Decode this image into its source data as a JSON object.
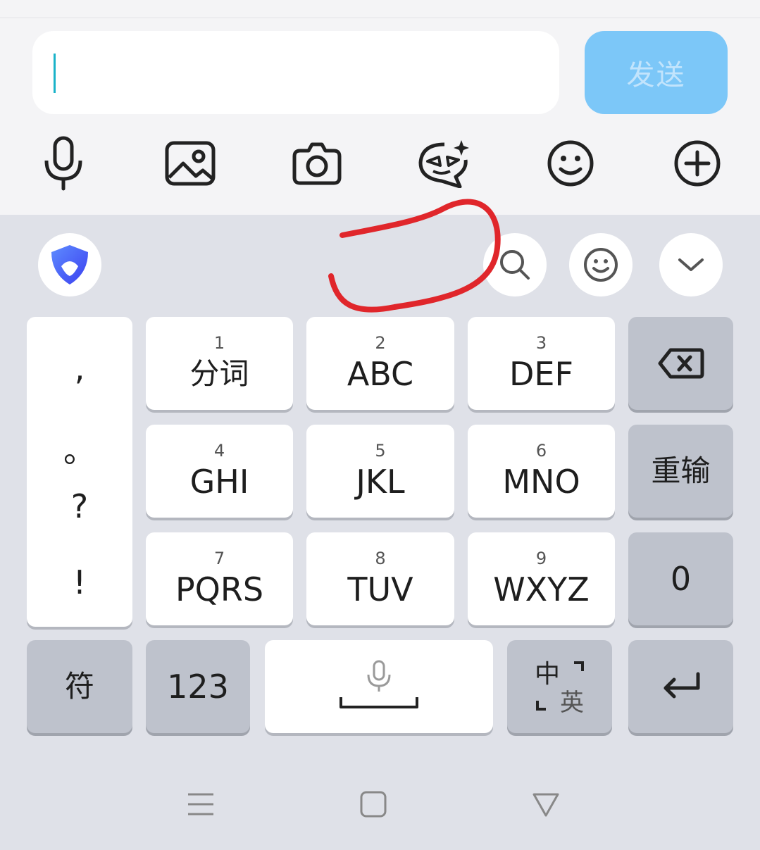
{
  "compose": {
    "input_value": "",
    "send_label": "发送"
  },
  "toolbar": {
    "icons": [
      "mic-icon",
      "image-icon",
      "camera-icon",
      "ai-assistant-icon",
      "emoji-icon",
      "plus-icon"
    ]
  },
  "keyboard": {
    "toolbar_icons": [
      "logo-icon",
      "search-icon",
      "emoji-icon",
      "collapse-icon"
    ],
    "punct": [
      ",",
      "。",
      "?",
      "!"
    ],
    "keys": [
      {
        "num": "1",
        "label": "分词"
      },
      {
        "num": "2",
        "label": "ABC"
      },
      {
        "num": "3",
        "label": "DEF"
      },
      {
        "num": "4",
        "label": "GHI"
      },
      {
        "num": "5",
        "label": "JKL"
      },
      {
        "num": "6",
        "label": "MNO"
      },
      {
        "num": "7",
        "label": "PQRS"
      },
      {
        "num": "8",
        "label": "TUV"
      },
      {
        "num": "9",
        "label": "WXYZ"
      }
    ],
    "reenter_label": "重输",
    "zero_label": "0",
    "symbol_label": "符",
    "numeric_label": "123",
    "lang_main": "中",
    "lang_alt": "英"
  },
  "annotation_color": "#e0262b"
}
